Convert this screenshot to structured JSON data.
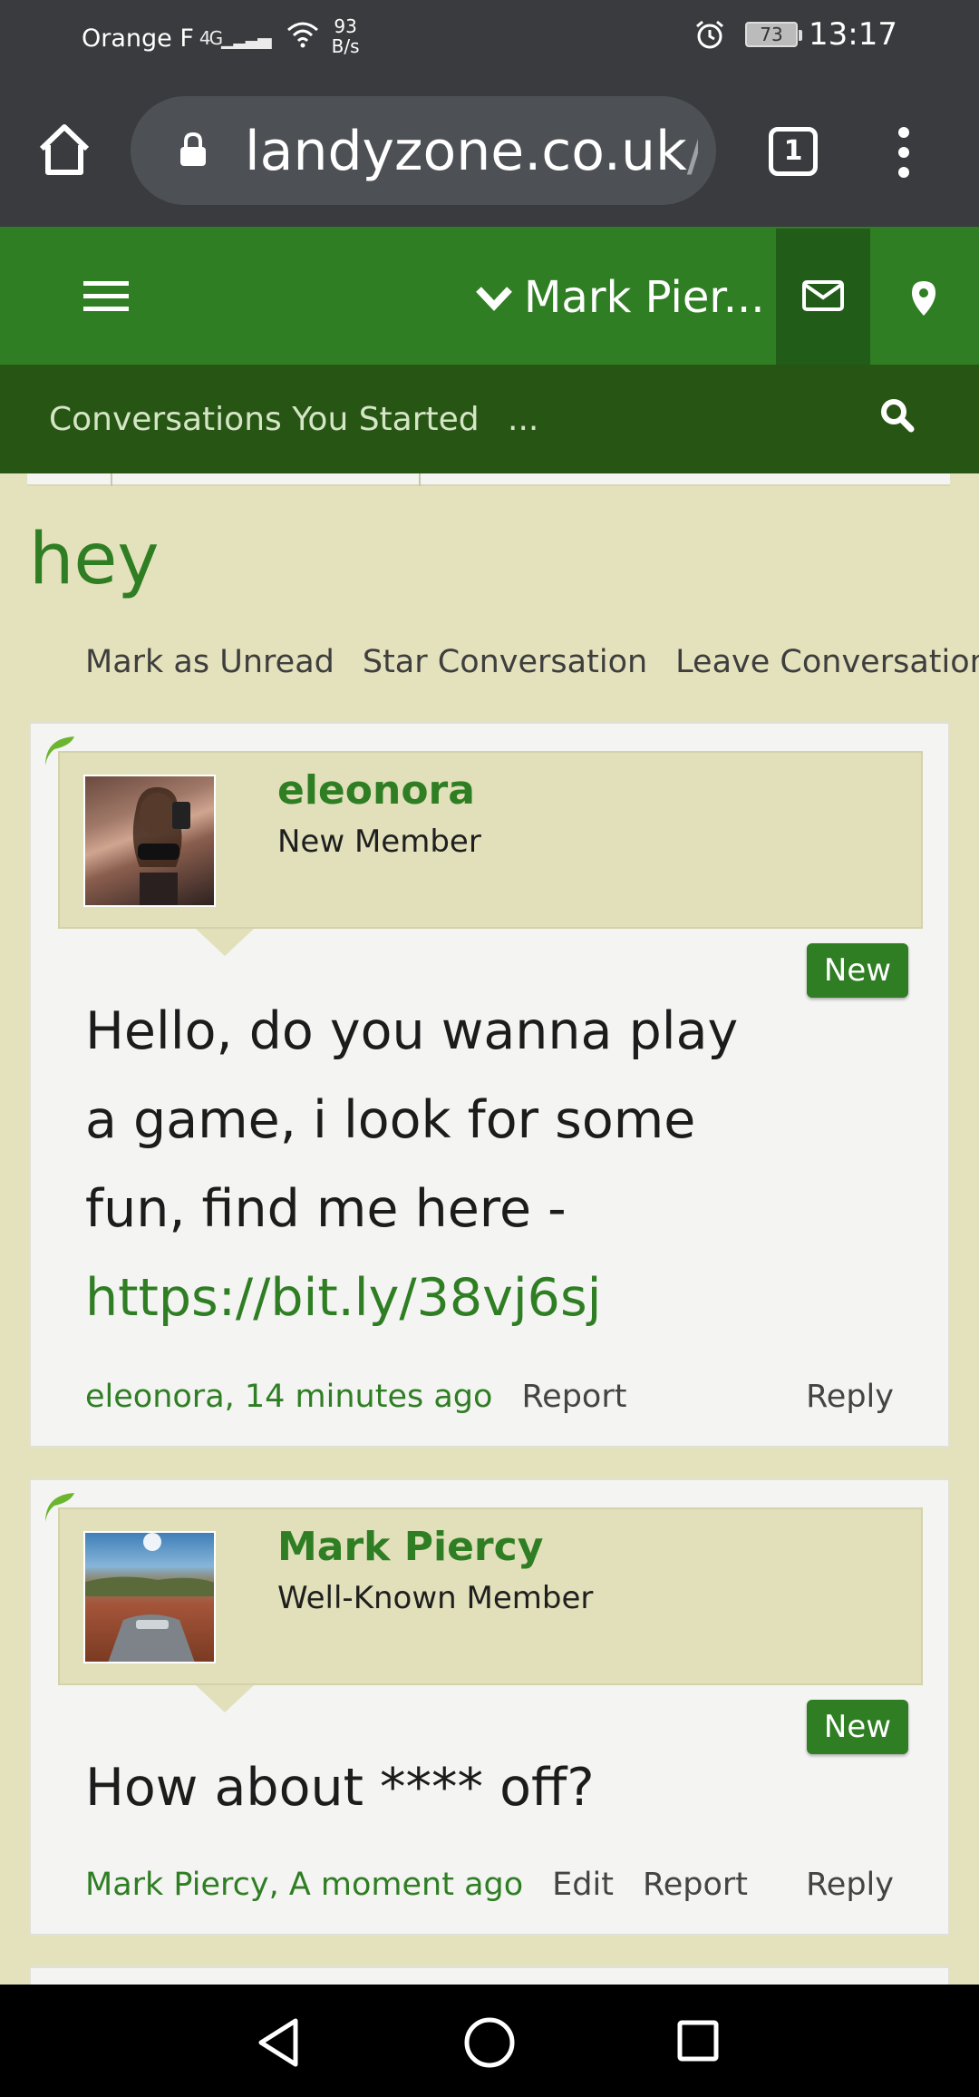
{
  "status_bar": {
    "carrier": "Orange F",
    "network": "4G",
    "speed_value": "93",
    "speed_unit": "B/s",
    "battery": "73",
    "time": "13:17"
  },
  "browser": {
    "url_main": "landyzone.co.uk",
    "url_rest": "/c",
    "tab_count": "1"
  },
  "site_nav": {
    "user_label": "Mark Pier..."
  },
  "sub_nav": {
    "item": "Conversations You Started",
    "more": "..."
  },
  "conversation": {
    "title": "hey",
    "actions": [
      "Mark as Unread",
      "Star Conversation",
      "Leave Conversation"
    ]
  },
  "messages": [
    {
      "username": "eleonora",
      "user_title": "New Member",
      "badge": "New",
      "text": "Hello, do you wanna play a game, i look for some fun, find me here -",
      "link": "https://bit.ly/38vj6sj",
      "byline": "eleonora, 14 minutes ago",
      "report": "Report",
      "reply": "Reply"
    },
    {
      "username": "Mark Piercy",
      "user_title": "Well-Known Member",
      "badge": "New",
      "text": "How about **** off?",
      "byline": "Mark Piercy, A moment ago",
      "edit": "Edit",
      "report": "Report",
      "reply": "Reply"
    }
  ],
  "colors": {
    "brand_green": "#2f7e23",
    "dark_green": "#275614",
    "page_bg": "#e4e2bc",
    "browser_chrome": "#393b3e"
  }
}
